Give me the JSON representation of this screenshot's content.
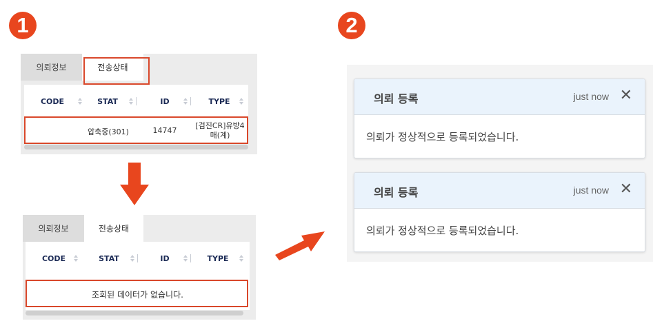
{
  "steps": [
    "1",
    "2"
  ],
  "tabs": {
    "request_info": "의뢰정보",
    "transfer_status": "전송상태"
  },
  "columns": [
    "CODE",
    "STAT",
    "ID",
    "TYPE"
  ],
  "panel_before": {
    "row": {
      "stat": "압축중(301)",
      "id": "14747",
      "type_line1": "[검진CR]유방4",
      "type_line2": "매(계)"
    }
  },
  "panel_after": {
    "empty_message": "조회된 데이터가 없습니다."
  },
  "toasts": [
    {
      "title": "의뢰 등록",
      "time": "just now",
      "close": "✕",
      "message": "의뢰가 정상적으로 등록되었습니다."
    },
    {
      "title": "의뢰 등록",
      "time": "just now",
      "close": "✕",
      "message": "의뢰가 정상적으로 등록되었습니다."
    }
  ],
  "colors": {
    "accent": "#e8461e",
    "highlight": "#d9472a",
    "header_text": "#1b2a55",
    "toast_header": "#eaf3fc"
  }
}
